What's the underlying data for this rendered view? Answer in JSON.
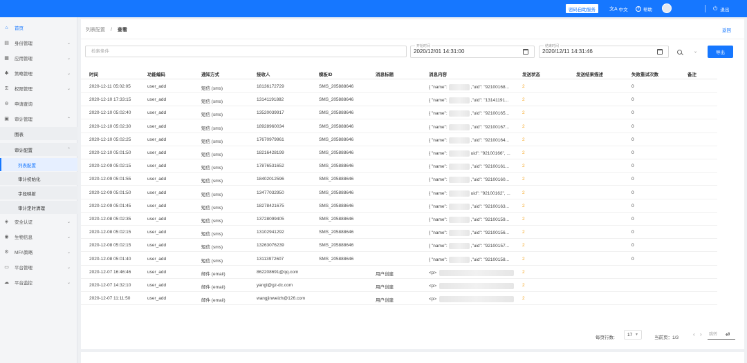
{
  "topbar": {
    "self_service": "密码自助服务",
    "language": "中文",
    "help": "帮助",
    "logout": "退出"
  },
  "sidebar": {
    "items": [
      {
        "label": "首页",
        "icon": "home-icon"
      },
      {
        "label": "身份管理",
        "icon": "id-card-icon"
      },
      {
        "label": "应用管理",
        "icon": "grid-icon"
      },
      {
        "label": "策略管理",
        "icon": "policy-icon"
      },
      {
        "label": "权限管理",
        "icon": "key-icon"
      },
      {
        "label": "申请查询",
        "icon": "search-doc-icon"
      },
      {
        "label": "审计管理",
        "icon": "audit-icon"
      }
    ],
    "audit_children": {
      "chart": "图表",
      "audit_config": "审计配置",
      "config_children": [
        "列表配置",
        "审计初始化",
        "字段映射",
        "审计定时清理"
      ]
    },
    "bottom_items": [
      {
        "label": "安全认证",
        "icon": "shield-icon"
      },
      {
        "label": "生物信息",
        "icon": "fingerprint-icon"
      },
      {
        "label": "MFA策略",
        "icon": "mfa-icon"
      },
      {
        "label": "平台管理",
        "icon": "monitor-icon"
      },
      {
        "label": "平台监控",
        "icon": "cloud-icon"
      }
    ]
  },
  "breadcrumb": {
    "parent": "列表配置",
    "sep": "/",
    "current": "查看"
  },
  "back_label": "返回",
  "filters": {
    "search_placeholder": "检索条件",
    "start_label": "开始时间",
    "start_value": "2020/12/01 14:31:00",
    "end_label": "结束时间",
    "end_value": "2020/12/11 14:31:46",
    "export_label": "导出"
  },
  "table": {
    "columns": [
      "时间",
      "功能编码",
      "通知方式",
      "接收人",
      "模板ID",
      "消息标题",
      "消息内容",
      "发送状态",
      "发送结果描述",
      "失败重试次数",
      "备注"
    ],
    "rows": [
      {
        "time": "2020-12-11 05:02:05",
        "code": "user_add",
        "method": "短信 (sms)",
        "receiver": "18136172729",
        "template": "SMS_205888646",
        "title": "",
        "content_pre": "{ \"name\":",
        "content_post": ",\"uid\": \"92100168...",
        "status": "2",
        "desc": "",
        "retry": "0",
        "remark": ""
      },
      {
        "time": "2020-12-10 17:33:15",
        "code": "user_add",
        "method": "短信 (sms)",
        "receiver": "13141191882",
        "template": "SMS_205888646",
        "title": "",
        "content_pre": "{ \"name\":",
        "content_post": ",\"uid\": \"13141191...",
        "status": "2",
        "desc": "",
        "retry": "0",
        "remark": ""
      },
      {
        "time": "2020-12-10 05:02:40",
        "code": "user_add",
        "method": "短信 (sms)",
        "receiver": "13520039917",
        "template": "SMS_205888646",
        "title": "",
        "content_pre": "{ \"name\":",
        "content_post": ",\"uid\": \"92100165...",
        "status": "2",
        "desc": "",
        "retry": "0",
        "remark": ""
      },
      {
        "time": "2020-12-10 05:02:30",
        "code": "user_add",
        "method": "短信 (sms)",
        "receiver": "18928960034",
        "template": "SMS_205888646",
        "title": "",
        "content_pre": "{ \"name\":",
        "content_post": ",\"uid\": \"92100167...",
        "status": "2",
        "desc": "",
        "retry": "0",
        "remark": ""
      },
      {
        "time": "2020-12-10 05:02:25",
        "code": "user_add",
        "method": "短信 (sms)",
        "receiver": "17670979961",
        "template": "SMS_205888646",
        "title": "",
        "content_pre": "{ \"name\":",
        "content_post": ",\"uid\": \"92100164...",
        "status": "2",
        "desc": "",
        "retry": "0",
        "remark": ""
      },
      {
        "time": "2020-12-10 05:01:50",
        "code": "user_add",
        "method": "短信 (sms)",
        "receiver": "18216428199",
        "template": "SMS_205888646",
        "title": "",
        "content_pre": "{ \"name\":",
        "content_post": "uid\": \"92100166\", ...",
        "status": "2",
        "desc": "",
        "retry": "0",
        "remark": ""
      },
      {
        "time": "2020-12-09 05:02:15",
        "code": "user_add",
        "method": "短信 (sms)",
        "receiver": "17876531652",
        "template": "SMS_205888646",
        "title": "",
        "content_pre": "{ \"name\":",
        "content_post": ",\"uid\": \"92100161...",
        "status": "2",
        "desc": "",
        "retry": "0",
        "remark": ""
      },
      {
        "time": "2020-12-09 05:01:55",
        "code": "user_add",
        "method": "短信 (sms)",
        "receiver": "18402012596",
        "template": "SMS_205888646",
        "title": "",
        "content_pre": "{ \"name\":",
        "content_post": ",\"uid\": \"92100160...",
        "status": "2",
        "desc": "",
        "retry": "0",
        "remark": ""
      },
      {
        "time": "2020-12-09 05:01:50",
        "code": "user_add",
        "method": "短信 (sms)",
        "receiver": "13477032950",
        "template": "SMS_205888646",
        "title": "",
        "content_pre": "{ \"name\":",
        "content_post": "uid\": \"92100162\", ...",
        "status": "2",
        "desc": "",
        "retry": "0",
        "remark": ""
      },
      {
        "time": "2020-12-09 05:01:45",
        "code": "user_add",
        "method": "短信 (sms)",
        "receiver": "18278421675",
        "template": "SMS_205888646",
        "title": "",
        "content_pre": "{ \"name\":",
        "content_post": ",\"uid\": \"92100163...",
        "status": "2",
        "desc": "",
        "retry": "0",
        "remark": ""
      },
      {
        "time": "2020-12-08 05:02:35",
        "code": "user_add",
        "method": "短信 (sms)",
        "receiver": "13728099405",
        "template": "SMS_205888646",
        "title": "",
        "content_pre": "{ \"name\":",
        "content_post": ",\"uid\": \"92100159...",
        "status": "2",
        "desc": "",
        "retry": "0",
        "remark": ""
      },
      {
        "time": "2020-12-08 05:02:15",
        "code": "user_add",
        "method": "短信 (sms)",
        "receiver": "13102941292",
        "template": "SMS_205888646",
        "title": "",
        "content_pre": "{ \"name\":",
        "content_post": ",\"uid\": \"92100156...",
        "status": "2",
        "desc": "",
        "retry": "0",
        "remark": ""
      },
      {
        "time": "2020-12-08 05:02:15",
        "code": "user_add",
        "method": "短信 (sms)",
        "receiver": "13263076239",
        "template": "SMS_205888646",
        "title": "",
        "content_pre": "{ \"name\":",
        "content_post": ",\"uid\": \"92100157...",
        "status": "2",
        "desc": "",
        "retry": "0",
        "remark": ""
      },
      {
        "time": "2020-12-08 05:01:40",
        "code": "user_add",
        "method": "短信 (sms)",
        "receiver": "13113972607",
        "template": "SMS_205888646",
        "title": "",
        "content_pre": "{ \"name\":",
        "content_post": ",\"uid\": \"92100158...",
        "status": "2",
        "desc": "",
        "retry": "0",
        "remark": ""
      },
      {
        "time": "2020-12-07 16:46:46",
        "code": "user_add",
        "method": "邮件 (email)",
        "receiver": "862208691@qq.com",
        "template": "",
        "title": "用户创建",
        "content_pre": "<p>",
        "content_post": "",
        "status": "2",
        "desc": "",
        "retry": "",
        "remark": ""
      },
      {
        "time": "2020-12-07 14:32:10",
        "code": "user_add",
        "method": "邮件 (email)",
        "receiver": "yangl@gz-dc.com",
        "template": "",
        "title": "用户创建",
        "content_pre": "<p>",
        "content_post": "",
        "status": "2",
        "desc": "",
        "retry": "",
        "remark": ""
      },
      {
        "time": "2020-12-07 11:11:50",
        "code": "user_add",
        "method": "邮件 (email)",
        "receiver": "wangjinweizh@126.com",
        "template": "",
        "title": "用户创建",
        "content_pre": "<p>",
        "content_post": "",
        "status": "2",
        "desc": "",
        "retry": "",
        "remark": ""
      }
    ]
  },
  "pagination": {
    "rows_per_page_label": "每页行数:",
    "rows_per_page": "17",
    "current_page_label": "当前页：1/3",
    "jump_placeholder": "跳转"
  },
  "colors": {
    "primary": "#1677ff",
    "status_warn": "#f5a623"
  }
}
